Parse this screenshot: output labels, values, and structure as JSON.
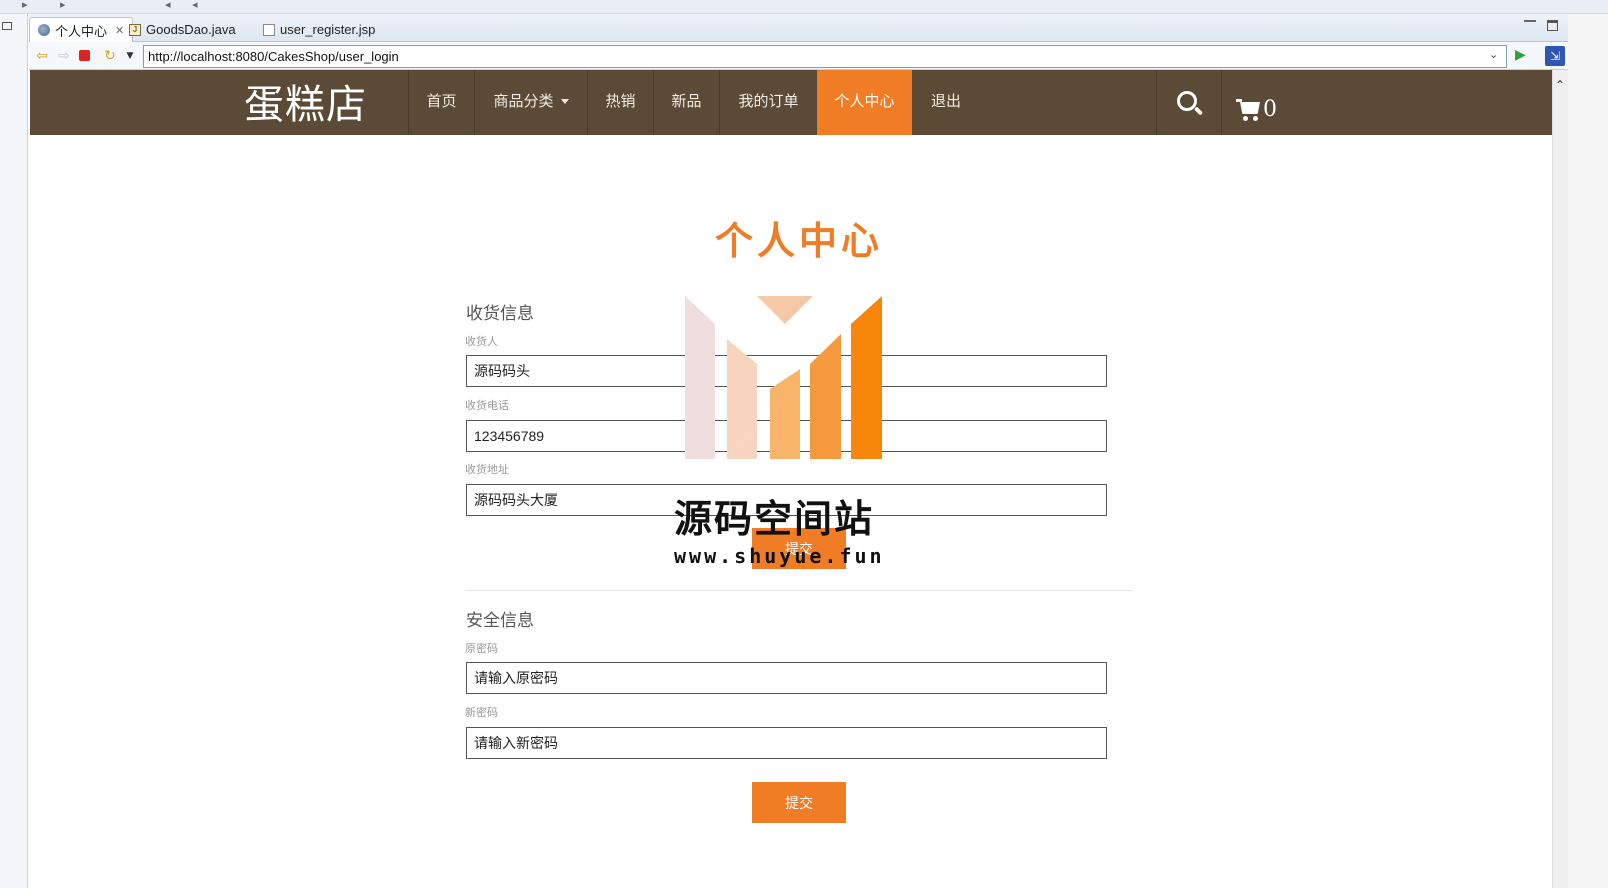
{
  "ide": {
    "tabs": [
      {
        "label": "个人中心",
        "icon": "globe-icon",
        "active": true
      },
      {
        "label": "GoodsDao.java",
        "icon": "java-file-icon",
        "active": false
      },
      {
        "label": "user_register.jsp",
        "icon": "jsp-file-icon",
        "active": false
      }
    ],
    "url": "http://localhost:8080/CakesShop/user_login"
  },
  "site": {
    "logo": "蛋糕店",
    "nav": [
      {
        "label": "首页",
        "active": false
      },
      {
        "label": "商品分类",
        "active": false,
        "has_dropdown": true
      },
      {
        "label": "热销",
        "active": false
      },
      {
        "label": "新品",
        "active": false
      },
      {
        "label": "我的订单",
        "active": false
      },
      {
        "label": "个人中心",
        "active": true
      },
      {
        "label": "退出",
        "active": false
      }
    ],
    "cart_count": "0",
    "colors": {
      "header_bg": "#5b4a36",
      "accent": "#f07c25"
    }
  },
  "page": {
    "title": "个人中心",
    "shipping": {
      "heading": "收货信息",
      "fields": [
        {
          "label": "收货人",
          "value": "源码码头"
        },
        {
          "label": "收货电话",
          "value": "123456789"
        },
        {
          "label": "收货地址",
          "value": "源码码头大厦"
        }
      ],
      "submit_label": "提交"
    },
    "security": {
      "heading": "安全信息",
      "fields": [
        {
          "label": "原密码",
          "placeholder": "请输入原密码"
        },
        {
          "label": "新密码",
          "placeholder": "请输入新密码"
        }
      ],
      "submit_label": "提交"
    }
  },
  "watermark": {
    "title": "源码空间站",
    "url": "www.shuyue.fun"
  }
}
